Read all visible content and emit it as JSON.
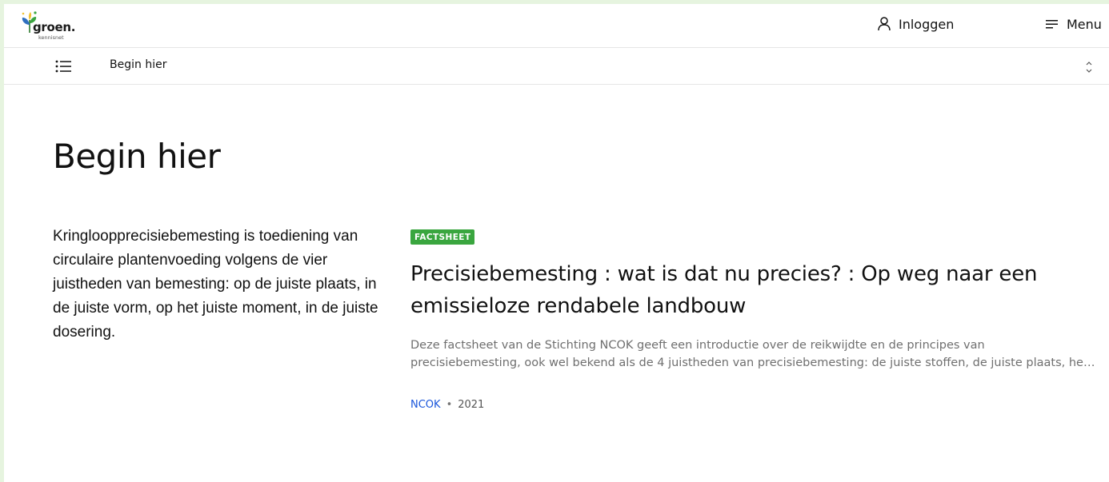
{
  "header": {
    "logo_text": "groen.",
    "logo_subtext": "kennisnet",
    "login_label": "Inloggen",
    "menu_label": "Menu"
  },
  "subbar": {
    "title": "Begin hier"
  },
  "main": {
    "title": "Begin hier",
    "intro": "Kringloopprecisiebemesting is toediening van circulaire plantenvoeding volgens de vier juistheden van bemesting: op de juiste plaats, in de juiste vorm, op het juiste moment, in de juiste dosering."
  },
  "card": {
    "badge": "FACTSHEET",
    "title": "Precisiebemesting : wat is dat nu precies? : Op weg naar een emissieloze rendabele landbouw",
    "description": "Deze factsheet van de Stichting NCOK geeft een introductie over de reikwijdte en de principes van precisiebemesting, ook wel bekend als de 4 juistheden van precisiebemesting: de juiste stoffen, de juiste plaats, het juiste moment en de juiste hoeveelheid.",
    "source": "NCOK",
    "separator": "•",
    "year": "2021"
  },
  "colors": {
    "frame": "#e6f4df",
    "badge": "#3aa63f",
    "link": "#1a56db"
  }
}
